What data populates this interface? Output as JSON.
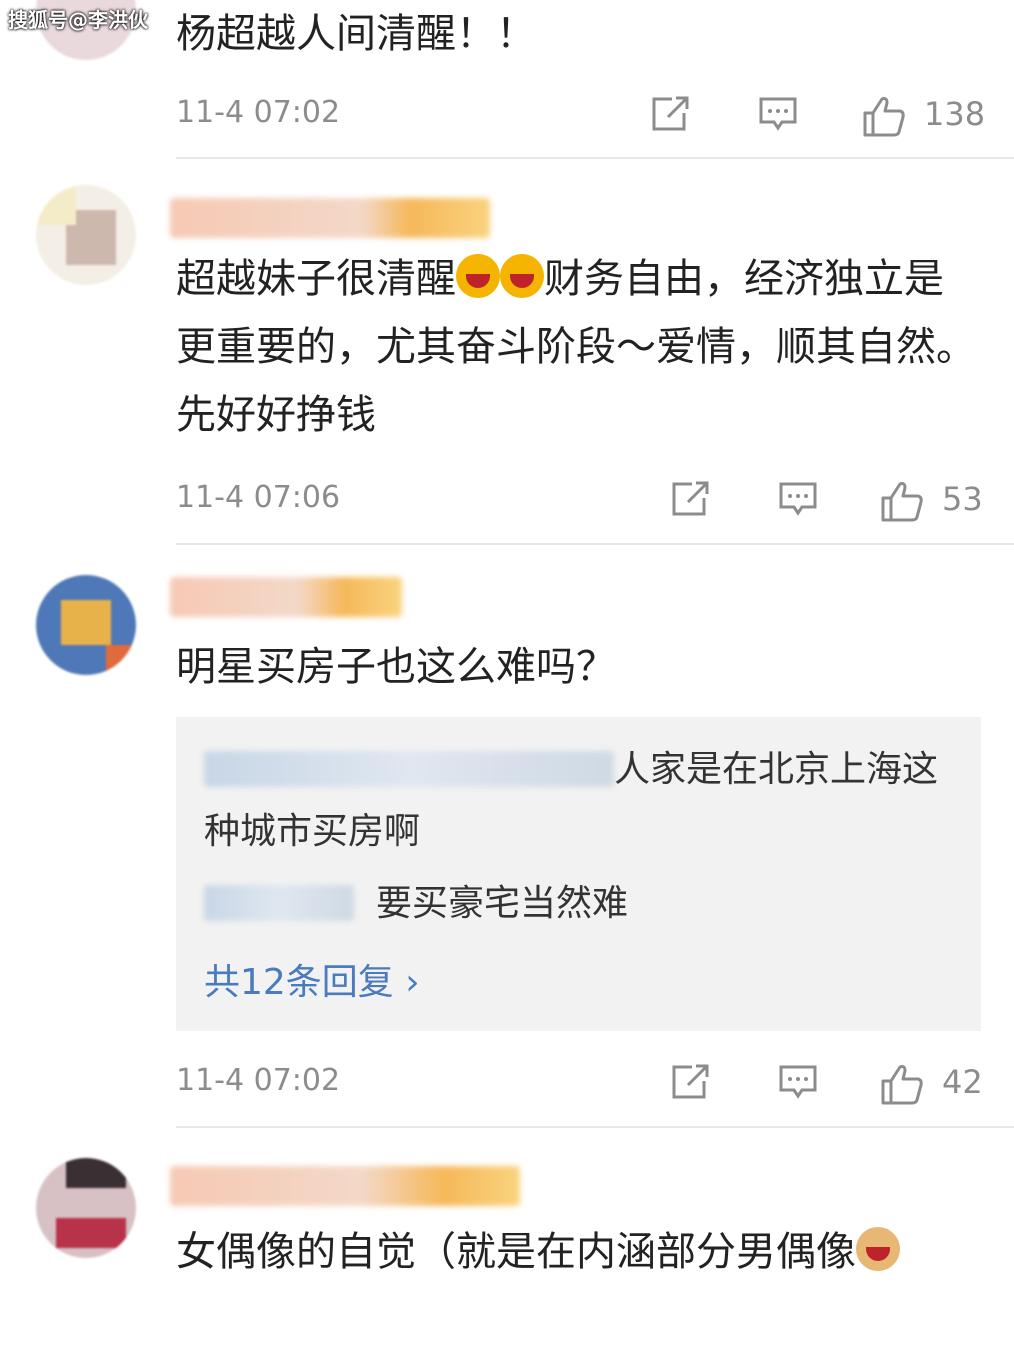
{
  "watermark": "搜狐号@李洪伙",
  "comments": [
    {
      "text": "杨超越人间清醒！！",
      "time": "11-4 07:02",
      "likes": "138"
    },
    {
      "text_a": "超越妹子很清醒",
      "text_b": "财务自由，经济独立是更重要的，尤其奋斗阶段～爱情，顺其自然。先好好挣钱",
      "time": "11-4 07:06",
      "likes": "53"
    },
    {
      "text": "明星买房子也这么难吗？",
      "replies": [
        {
          "text": "人家是在北京上海这种城市买房啊"
        },
        {
          "text": "要买豪宅当然难"
        }
      ],
      "more_replies": "共12条回复 ›",
      "time": "11-4 07:02",
      "likes": "42"
    },
    {
      "text": "女偶像的自觉（就是在内涵部分男偶像"
    }
  ],
  "icons": {
    "repost": "repost-icon",
    "comment": "comment-icon",
    "like": "like-icon",
    "emoji_laugh": "laugh-emoji",
    "emoji_doge": "doge-emoji"
  },
  "colors": {
    "link": "#4a7bbd",
    "meta": "#8c8c8c",
    "reply_bg": "#f2f2f2"
  }
}
